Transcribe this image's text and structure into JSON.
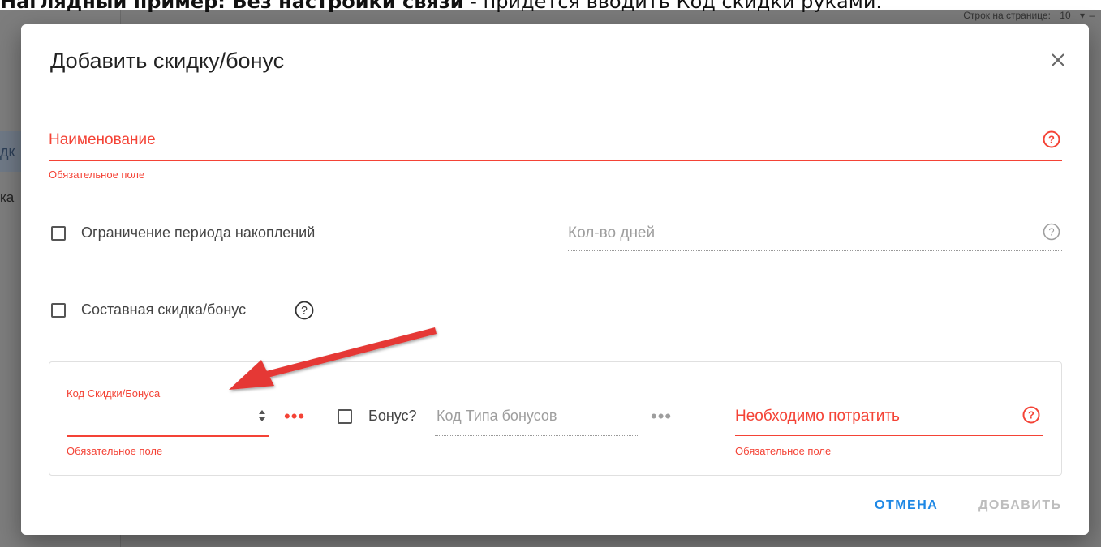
{
  "caption": {
    "bold": "Наглядный пример: Без настройки связи",
    "rest": " - придется вводить Код скидки руками."
  },
  "background": {
    "rows_per_page_label": "Строк на странице:",
    "rows_per_page_value": "10",
    "dash": "–",
    "frag1": "дк",
    "frag2": "ка"
  },
  "dialog": {
    "title": "Добавить скидку/бонус",
    "name_field": {
      "label": "Наименование",
      "error": "Обязательное поле"
    },
    "limit_period": {
      "label": "Ограничение периода накоплений",
      "days_placeholder": "Кол-во дней"
    },
    "composite": {
      "label": "Составная скидка/бонус"
    },
    "card": {
      "code_label": "Код Скидки/Бонуса",
      "code_error": "Обязательное поле",
      "bonus_label": "Бонус?",
      "bonus_type_placeholder": "Код Типа бонусов",
      "spend_label": "Необходимо потратить",
      "spend_error": "Обязательное поле",
      "ellipsis": "•••"
    },
    "buttons": {
      "cancel": "ОТМЕНА",
      "add": "ДОБАВИТЬ"
    }
  },
  "colors": {
    "error": "#f44336",
    "primary": "#1e88e5",
    "disabled": "#bdbdbd",
    "arrow": "#e53935"
  },
  "icons": [
    "close-icon",
    "help-icon",
    "spinner-icon",
    "more-icon",
    "checkbox-icon",
    "annotation-arrow"
  ]
}
